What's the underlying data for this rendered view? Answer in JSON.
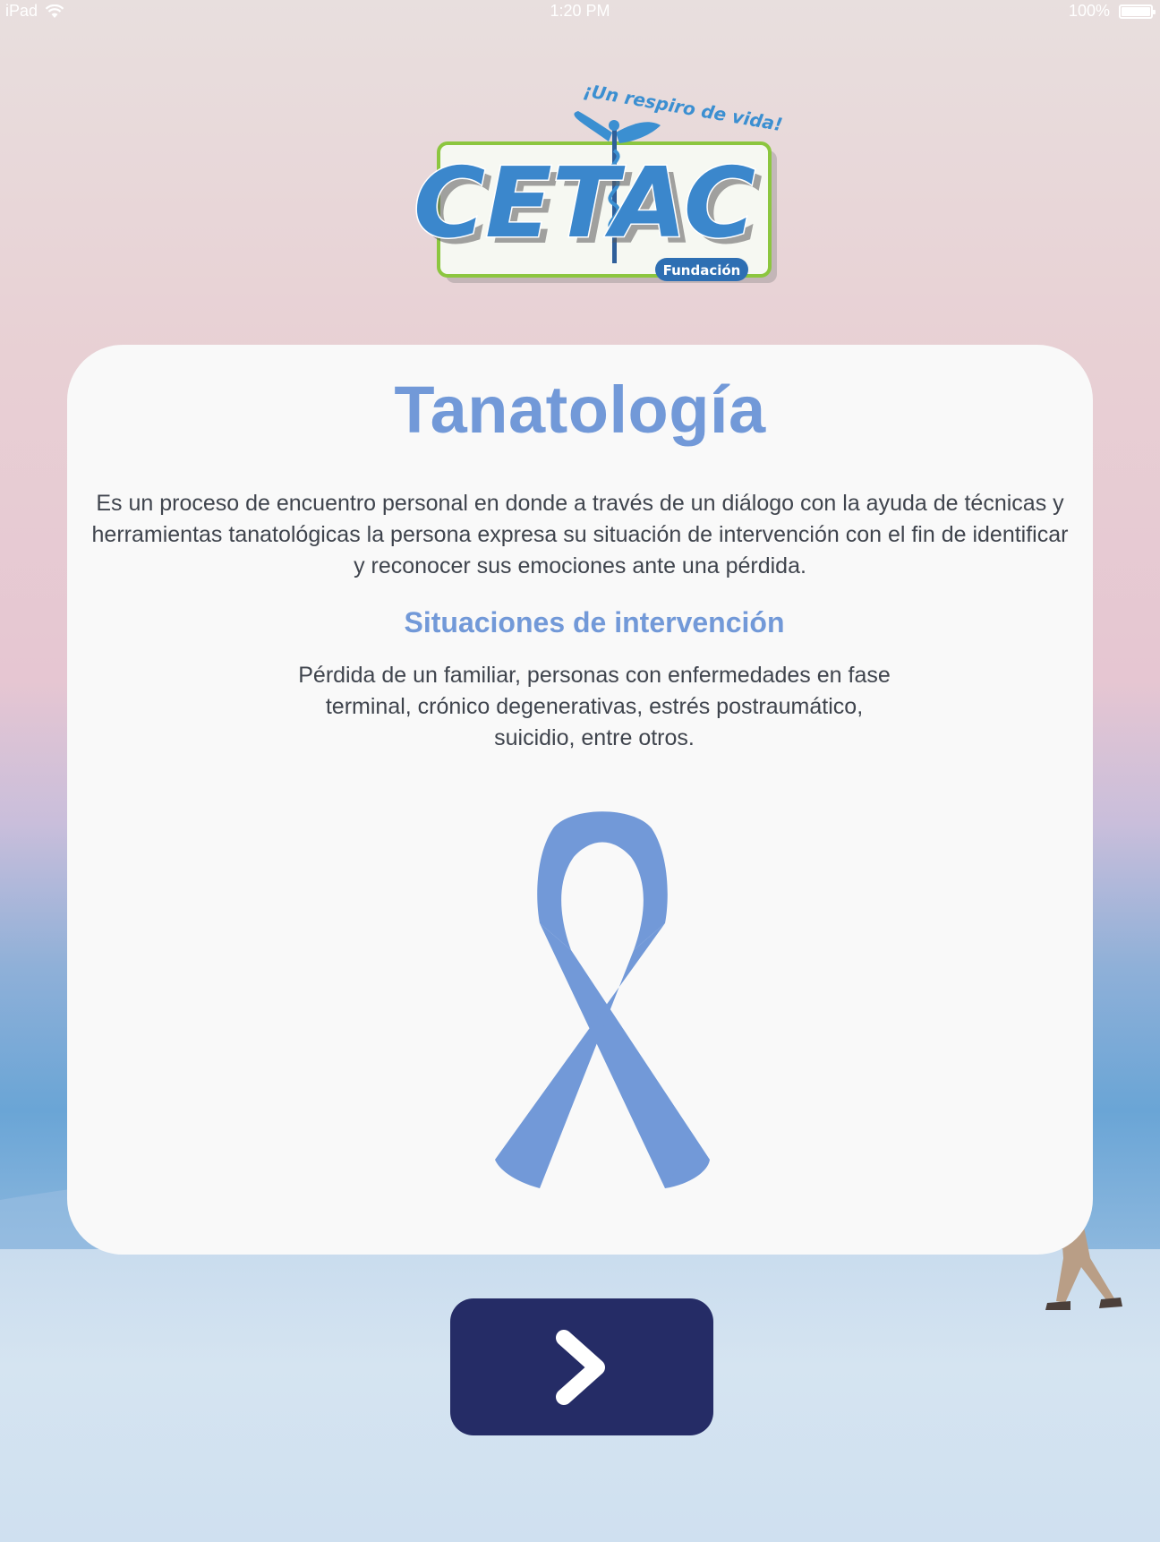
{
  "status_bar": {
    "device": "iPad",
    "time": "1:20 PM",
    "battery_percent": "100%",
    "battery_level": 1.0
  },
  "logo": {
    "slogan": "¡Un respiro de vida!",
    "name": "CETAC",
    "tag": "Fundación"
  },
  "card": {
    "title": "Tanatología",
    "description": "Es un proceso de encuentro personal en donde a través de un diálogo con la ayuda de técnicas y herramientas tanatológicas la persona expresa su situación de intervención con el fin de identificar y reconocer sus emociones ante una pérdida.",
    "subtitle": "Situaciones de intervención",
    "situations": "Pérdida de un familiar, personas con enfermedades en fase terminal, crónico degenerativas, estrés postraumático, suicidio, entre otros."
  },
  "colors": {
    "accent": "#7299d8",
    "button": "#252c66",
    "text": "#3f444d",
    "card": "#f9f9f9"
  },
  "icons": {
    "ribbon": "awareness-ribbon-icon",
    "next": "chevron-right-icon"
  }
}
